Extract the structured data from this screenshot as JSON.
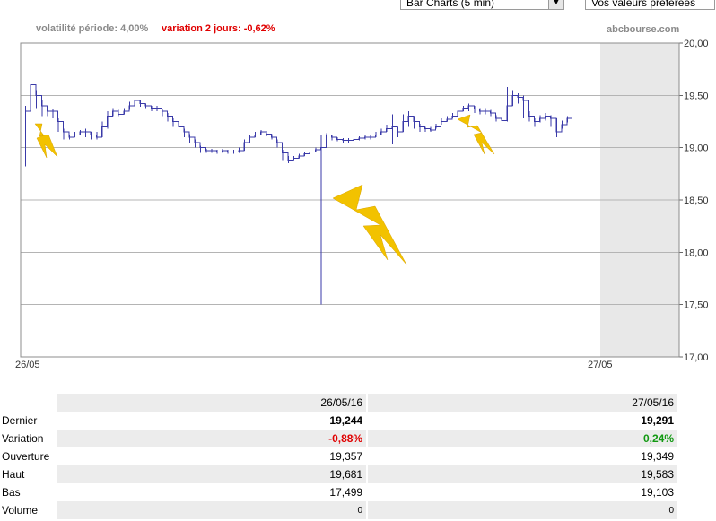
{
  "controls": {
    "chart_type_select": "Bar Charts (5 min)",
    "favorites_select": "Vos valeurs préférées"
  },
  "header": {
    "volatility": "volatilité période: 4,00%",
    "variation_2days": "variation 2 jours: -0,62%",
    "brand": "abcbourse.com"
  },
  "colors": {
    "series": "#3a3aa8",
    "negative": "#e00000",
    "positive": "#119911",
    "grid": "#b4b4b4",
    "shade": "#e8e8e8"
  },
  "chart_data": {
    "type": "line",
    "title": "",
    "ylim": [
      17.0,
      20.0
    ],
    "yticks": [
      "17,00",
      "17,50",
      "18,00",
      "18,50",
      "19,00",
      "19,50",
      "20,00"
    ],
    "xtick_labels": [
      "26/05",
      "27/05"
    ],
    "grid": true,
    "shaded_period": "27/05",
    "x": [
      0,
      1,
      2,
      3,
      4,
      5,
      6,
      7,
      8,
      9,
      10,
      11,
      12,
      13,
      14,
      15,
      16,
      17,
      18,
      19,
      20,
      21,
      22,
      23,
      24,
      25,
      26,
      27,
      28,
      29,
      30,
      31,
      32,
      33,
      34,
      35,
      36,
      37,
      38,
      39,
      40,
      41,
      42,
      43,
      44,
      45,
      46,
      47,
      48,
      49,
      50,
      51,
      52,
      53,
      54,
      55,
      56,
      57,
      58,
      59,
      60,
      61,
      62,
      63,
      64,
      65,
      66,
      67,
      68,
      69,
      70,
      71,
      72,
      73,
      74,
      75,
      76,
      77,
      78,
      79,
      80,
      81,
      82,
      83,
      84,
      85,
      86,
      87,
      88,
      89,
      90,
      91,
      92,
      93,
      94,
      95,
      96,
      97,
      98,
      99,
      100,
      101,
      102,
      103,
      104,
      105,
      106,
      107,
      108,
      109,
      110,
      111,
      112,
      113,
      114,
      115,
      116,
      117,
      118,
      119
    ],
    "series": [
      {
        "values": [
          19.35,
          19.6,
          19.5,
          19.4,
          19.35,
          19.35,
          19.25,
          19.15,
          19.1,
          19.12,
          19.15,
          19.15,
          19.12,
          19.1,
          19.2,
          19.3,
          19.35,
          19.32,
          19.35,
          19.4,
          19.45,
          19.42,
          19.4,
          19.38,
          19.38,
          19.35,
          19.3,
          19.25,
          19.2,
          19.15,
          19.1,
          19.05,
          19.0,
          18.97,
          18.97,
          18.96,
          18.97,
          18.96,
          18.96,
          18.97,
          19.05,
          19.1,
          19.12,
          19.15,
          19.13,
          19.1,
          19.05,
          18.95,
          18.88,
          18.9,
          18.92,
          18.94,
          18.96,
          18.98,
          19.0,
          19.12,
          19.1,
          19.08,
          19.07,
          19.07,
          19.08,
          19.09,
          19.1,
          19.1,
          19.12,
          19.15,
          19.18,
          19.2,
          19.15,
          19.25,
          19.3,
          19.25,
          19.2,
          19.18,
          19.17,
          19.2,
          19.25,
          19.27,
          19.3,
          19.35,
          19.38,
          19.4,
          19.37,
          19.35,
          19.35,
          19.33,
          19.28,
          19.26,
          19.4,
          19.5,
          19.48,
          19.45,
          19.3,
          19.25,
          19.28,
          19.3,
          19.28,
          19.15,
          19.22,
          19.28
        ],
        "high": [
          19.4,
          19.68,
          19.55,
          19.45,
          19.38,
          19.37,
          19.28,
          19.18,
          19.12,
          19.15,
          19.17,
          19.18,
          19.15,
          19.15,
          19.25,
          19.35,
          19.38,
          19.36,
          19.38,
          19.44,
          19.46,
          19.45,
          19.42,
          19.4,
          19.4,
          19.37,
          19.33,
          19.28,
          19.23,
          19.18,
          19.13,
          19.08,
          19.02,
          18.99,
          18.99,
          18.98,
          18.99,
          18.98,
          18.98,
          19.0,
          19.08,
          19.12,
          19.15,
          19.17,
          19.16,
          19.13,
          19.08,
          18.98,
          18.92,
          18.92,
          18.94,
          18.96,
          18.98,
          19.0,
          19.12,
          19.14,
          19.12,
          19.1,
          19.09,
          19.09,
          19.1,
          19.11,
          19.12,
          19.12,
          19.15,
          19.18,
          19.22,
          19.32,
          19.2,
          19.32,
          19.35,
          19.3,
          19.23,
          19.2,
          19.2,
          19.23,
          19.28,
          19.3,
          19.33,
          19.38,
          19.4,
          19.42,
          19.4,
          19.38,
          19.38,
          19.36,
          19.31,
          19.29,
          19.58,
          19.55,
          19.52,
          19.5,
          19.35,
          19.28,
          19.31,
          19.33,
          19.31,
          19.28,
          19.26,
          19.3
        ],
        "low": [
          18.82,
          19.35,
          19.38,
          19.3,
          19.3,
          19.28,
          19.15,
          19.08,
          19.08,
          19.1,
          19.12,
          19.1,
          19.08,
          19.08,
          19.1,
          19.18,
          19.3,
          19.3,
          19.32,
          19.36,
          19.4,
          19.39,
          19.38,
          19.35,
          19.35,
          19.3,
          19.25,
          19.2,
          19.15,
          19.1,
          19.05,
          19.0,
          18.95,
          18.95,
          18.95,
          18.94,
          18.95,
          18.94,
          18.94,
          18.95,
          18.97,
          19.05,
          19.1,
          19.12,
          19.11,
          19.08,
          19.0,
          18.88,
          18.85,
          18.88,
          18.9,
          18.92,
          18.94,
          18.96,
          17.5,
          19.08,
          19.07,
          19.06,
          19.05,
          19.05,
          19.06,
          19.07,
          19.08,
          19.08,
          19.1,
          19.12,
          19.15,
          19.03,
          19.1,
          19.15,
          19.2,
          19.18,
          19.15,
          19.15,
          19.15,
          19.18,
          19.22,
          19.25,
          19.28,
          19.32,
          19.35,
          19.35,
          19.33,
          19.32,
          19.32,
          19.3,
          19.25,
          19.24,
          19.25,
          19.4,
          19.42,
          19.28,
          19.25,
          19.2,
          19.24,
          19.26,
          19.2,
          19.1,
          19.18,
          19.24
        ]
      }
    ]
  },
  "table": {
    "headers": [
      "26/05/16",
      "27/05/16"
    ],
    "rows": [
      {
        "label": "Dernier",
        "v1": "19,244",
        "v2": "19,291"
      },
      {
        "label": "Variation",
        "v1": "-0,88%",
        "v2": "0,24%"
      },
      {
        "label": "Ouverture",
        "v1": "19,357",
        "v2": "19,349"
      },
      {
        "label": "Haut",
        "v1": "19,681",
        "v2": "19,583"
      },
      {
        "label": "Bas",
        "v1": "17,499",
        "v2": "19,103"
      },
      {
        "label": "Volume",
        "v1": "0",
        "v2": "0"
      }
    ]
  }
}
